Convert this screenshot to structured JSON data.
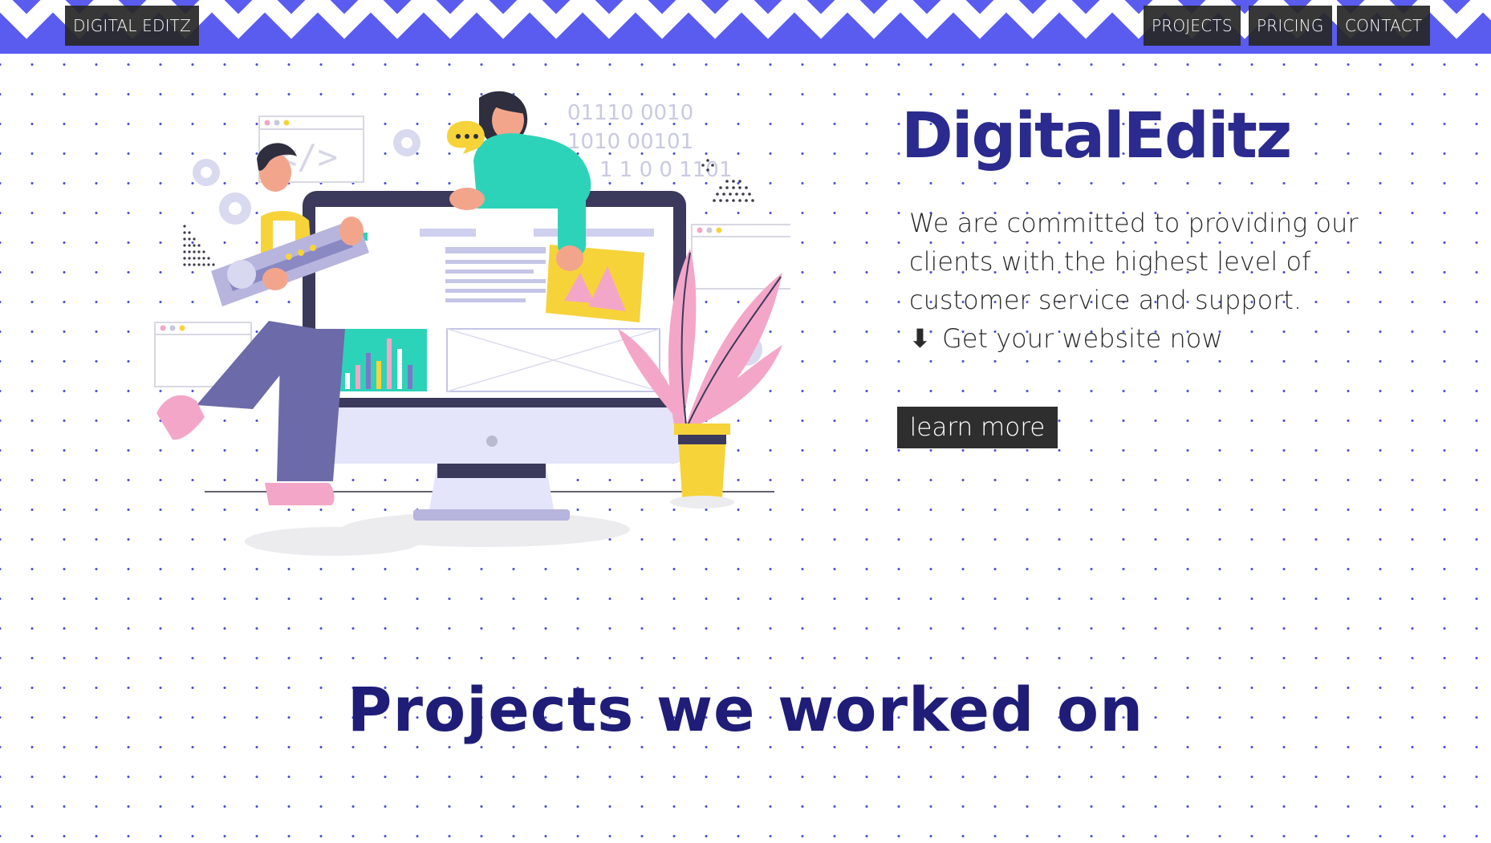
{
  "nav": {
    "brand": "DIGITAL EDITZ",
    "items": [
      {
        "label": "PROJECTS"
      },
      {
        "label": "PRICING"
      },
      {
        "label": "CONTACT"
      }
    ]
  },
  "hero": {
    "title": "DigitalEditz",
    "description": "We are committed to providing our clients with the highest level of customer service and support.",
    "cta_arrow": "⬇",
    "cta_text": "Get your website now",
    "button_label": "learn more",
    "binary_lines": [
      "01110 0010",
      "1010 00101",
      "1 1 0 0 1101"
    ]
  },
  "sections": {
    "projects_title": "Projects we worked on"
  },
  "colors": {
    "accent": "#5a5cf0",
    "title": "#2b2a8e",
    "dark_button": "#2e2e2e",
    "dot": "#4d4fd6"
  }
}
